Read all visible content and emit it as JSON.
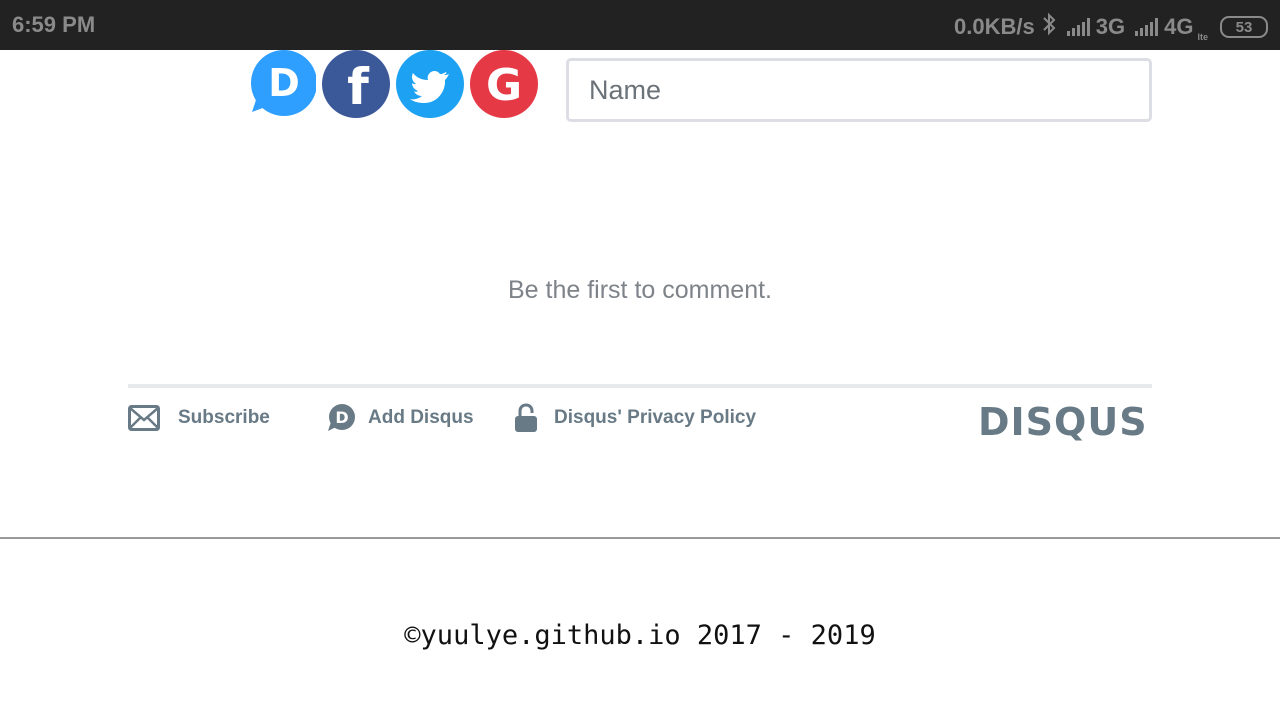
{
  "status_bar": {
    "time": "6:59 PM",
    "net_speed": "0.0KB/s",
    "network_1": "3G",
    "network_2": "4G",
    "network_2_sub": "lte",
    "battery": "53"
  },
  "login": {
    "providers": [
      {
        "name": "Disqus",
        "icon": "disqus-icon",
        "color": "#2e9fff"
      },
      {
        "name": "Facebook",
        "icon": "facebook-icon",
        "color": "#3b5998"
      },
      {
        "name": "Twitter",
        "icon": "twitter-icon",
        "color": "#1da1f2"
      },
      {
        "name": "Google",
        "icon": "google-icon",
        "color": "#dd4b39"
      }
    ],
    "name_placeholder": "Name"
  },
  "comments": {
    "empty_message": "Be the first to comment."
  },
  "footer": {
    "subscribe_label": "Subscribe",
    "add_disqus_label": "Add Disqus",
    "privacy_label": "Disqus' Privacy Policy",
    "brand": "DISQUS",
    "text_color": "#687a86"
  },
  "page_footer": {
    "copyright": "©yuulye.github.io 2017 - 2019"
  }
}
